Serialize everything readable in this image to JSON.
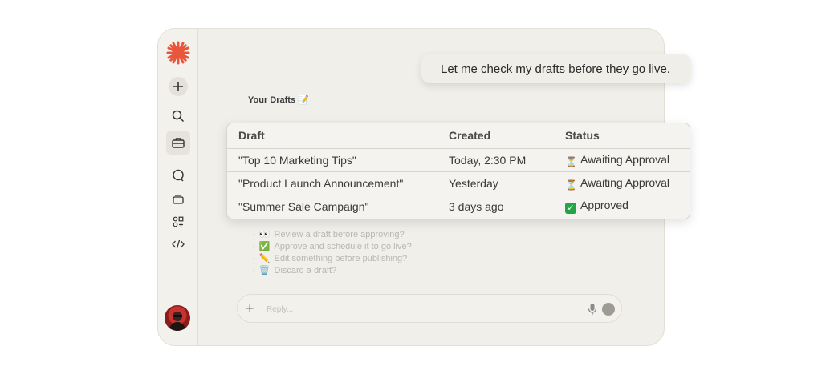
{
  "sidebar": {
    "items": [
      "new-chat",
      "search",
      "toolbox",
      "chat",
      "layers",
      "apps",
      "code"
    ]
  },
  "user_message": "Let me check my drafts before they go live.",
  "drafts_section": {
    "title": "Your Drafts 📝"
  },
  "table": {
    "headers": [
      "Draft",
      "Created",
      "Status"
    ],
    "rows": [
      {
        "draft": "\"Top 10 Marketing Tips\"",
        "created": "Today, 2:30 PM",
        "status": "Awaiting Approval",
        "status_icon": "hourglass-icon"
      },
      {
        "draft": "\"Product Launch Announcement\"",
        "created": "Yesterday",
        "status": "Awaiting Approval",
        "status_icon": "hourglass-icon"
      },
      {
        "draft": "\"Summer Sale Campaign\"",
        "created": "3 days ago",
        "status": "Approved",
        "status_icon": "check-icon"
      }
    ]
  },
  "suggestions": [
    {
      "icon": "👀",
      "text": "Review a draft before approving?"
    },
    {
      "icon": "✅",
      "text": "Approve and schedule it to go live?"
    },
    {
      "icon": "✏️",
      "text": "Edit something before publishing?"
    },
    {
      "icon": "🗑️",
      "text": "Discard a draft?"
    }
  ],
  "composer": {
    "placeholder": "Reply..."
  },
  "colors": {
    "accent": "#e8553a",
    "approved": "#22a447",
    "background": "#f1efea"
  }
}
